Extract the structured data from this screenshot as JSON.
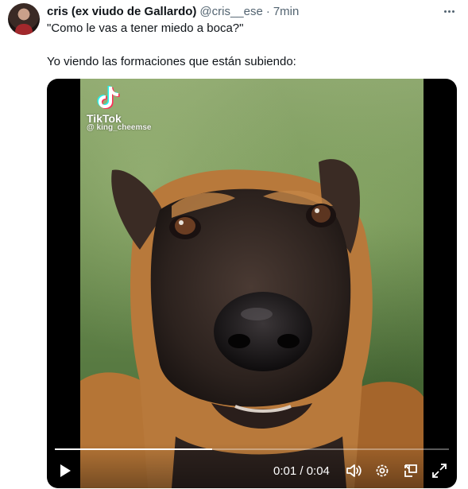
{
  "tweet": {
    "author": {
      "display_name": "cris (ex viudo de Gallardo)",
      "handle": "@cris__ese",
      "separator": "·",
      "time": "7min"
    },
    "text_lines": [
      "\"Como le vas a tener miedo a boca?\"",
      "Yo viendo las formaciones que están subiendo:"
    ]
  },
  "video": {
    "watermark": {
      "brand": "TikTok",
      "username": "@ king_cheemse"
    },
    "time_display": "0:01 / 0:04",
    "progress": 0.4,
    "icons": [
      "play-icon",
      "volume-icon",
      "settings-gear-icon",
      "picture-in-picture-icon",
      "fullscreen-icon"
    ]
  }
}
